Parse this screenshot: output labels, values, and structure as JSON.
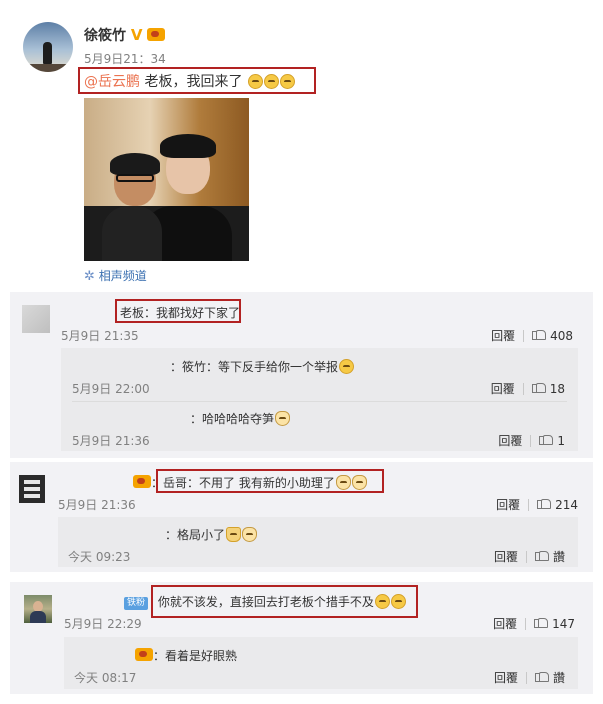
{
  "post": {
    "author": "徐筱竹",
    "time": "5月9日21：34",
    "mention": "@岳云鹏",
    "text": " 老板，我回来了",
    "channel_link": "相声频道"
  },
  "comments": [
    {
      "text": "老板：我都找好下家了",
      "time": "5月9日 21:35",
      "reply_label": "回覆",
      "likes": "408",
      "replies": [
        {
          "text": "：筱竹：等下反手给你一个举报",
          "time": "5月9日 22:00",
          "reply_label": "回覆",
          "likes": "18"
        },
        {
          "text": "：哈哈哈哈夺笋",
          "time": "5月9日 21:36",
          "reply_label": "回覆",
          "likes": "1"
        }
      ]
    },
    {
      "text": "：岳哥：不用了 我有新的小助理了",
      "time": "5月9日 21:36",
      "reply_label": "回覆",
      "likes": "214",
      "replies": [
        {
          "text": "：格局小了",
          "time": "今天 09:23",
          "reply_label": "回覆",
          "likes": "讚"
        }
      ]
    },
    {
      "tag": "铁粉",
      "text": "你就不该发，直接回去打老板个措手不及",
      "time": "5月9日 22:29",
      "reply_label": "回覆",
      "likes": "147",
      "replies": [
        {
          "text": "：看着是好眼熟",
          "time": "今天 08:17",
          "reply_label": "回覆",
          "likes": "讚"
        }
      ]
    }
  ],
  "colors": {
    "link": "#eb7350",
    "highlight_box": "#b22222",
    "panel": "#f2f2f5",
    "vip": "#f5a300"
  },
  "icons": [
    "avatar",
    "vip-v-icon",
    "fan-badge-icon",
    "emoji-icon",
    "thumbs-up-icon",
    "channel-icon"
  ]
}
